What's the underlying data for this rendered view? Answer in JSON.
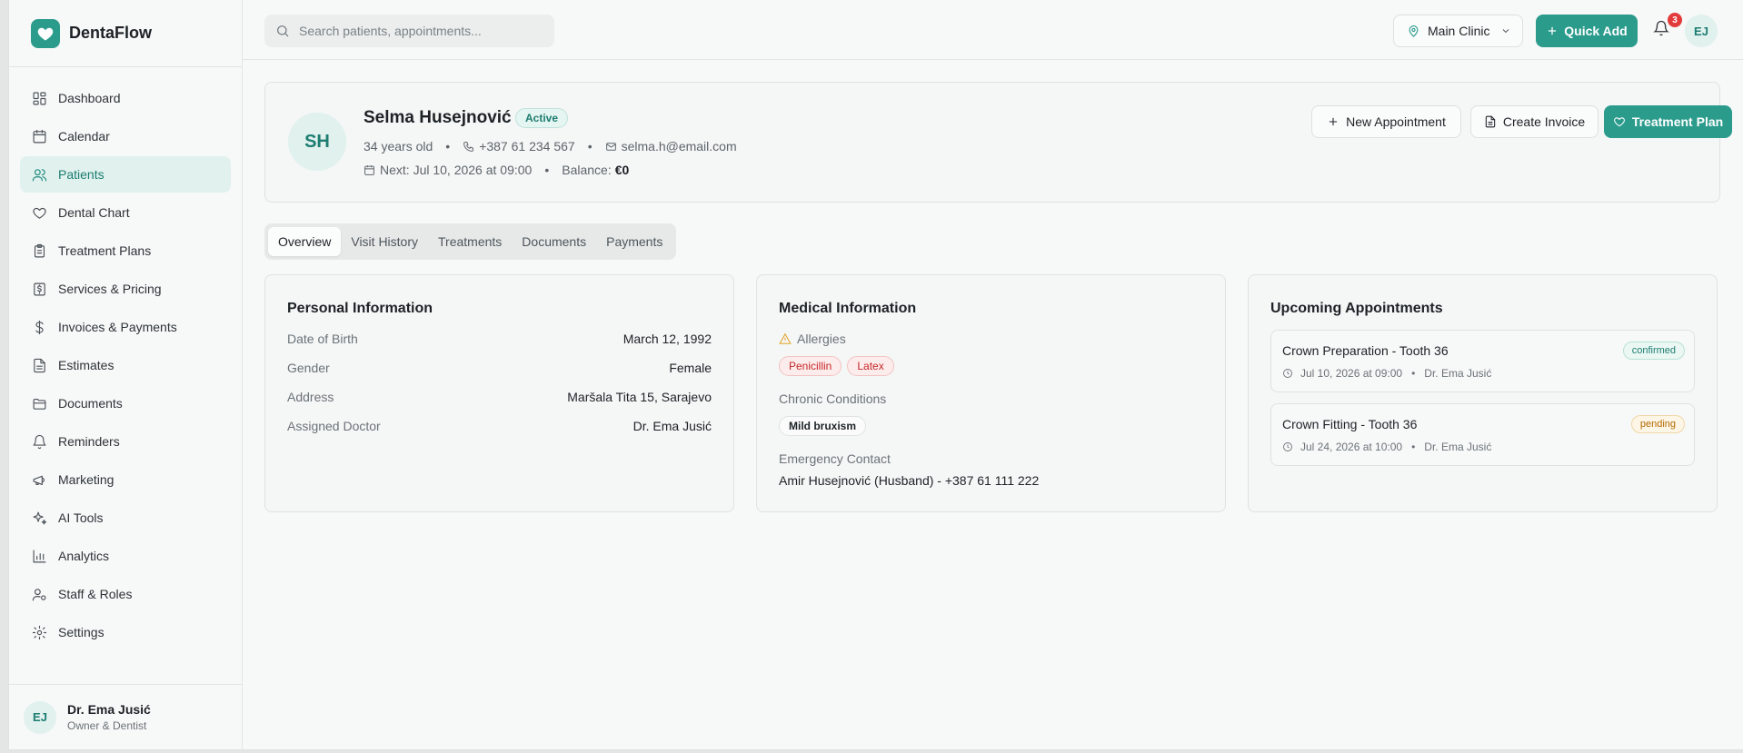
{
  "brand": {
    "name": "DentaFlow",
    "accent": "#2b9b8c"
  },
  "sidebar": {
    "items": [
      {
        "label": "Dashboard",
        "icon": "dashboard-icon"
      },
      {
        "label": "Calendar",
        "icon": "calendar-icon"
      },
      {
        "label": "Patients",
        "icon": "users-icon",
        "active": true
      },
      {
        "label": "Dental Chart",
        "icon": "heart-icon"
      },
      {
        "label": "Treatment Plans",
        "icon": "clipboard-icon"
      },
      {
        "label": "Services & Pricing",
        "icon": "pricing-icon"
      },
      {
        "label": "Invoices & Payments",
        "icon": "dollar-icon"
      },
      {
        "label": "Estimates",
        "icon": "file-icon"
      },
      {
        "label": "Documents",
        "icon": "folder-icon"
      },
      {
        "label": "Reminders",
        "icon": "bell-icon"
      },
      {
        "label": "Marketing",
        "icon": "megaphone-icon"
      },
      {
        "label": "AI Tools",
        "icon": "sparkles-icon"
      },
      {
        "label": "Analytics",
        "icon": "bar-chart-icon"
      },
      {
        "label": "Staff & Roles",
        "icon": "user-cog-icon"
      },
      {
        "label": "Settings",
        "icon": "gear-icon"
      }
    ],
    "user": {
      "initials": "EJ",
      "name": "Dr. Ema Jusić",
      "role": "Owner & Dentist"
    }
  },
  "topbar": {
    "search_placeholder": "Search patients, appointments...",
    "clinic": "Main Clinic",
    "quick_add": "Quick Add",
    "notifications": "3",
    "avatar_initials": "EJ"
  },
  "patient": {
    "initials": "SH",
    "name": "Selma Husejnović",
    "status": "Active",
    "age": "34 years old",
    "phone": "+387 61 234 567",
    "email": "selma.h@email.com",
    "next": "Next: Jul 10, 2026 at 09:00",
    "balance_label": "Balance:",
    "balance_value": "€0",
    "actions": {
      "new_appointment": "New Appointment",
      "create_invoice": "Create Invoice",
      "treatment_plan": "Treatment Plan"
    }
  },
  "tabs": [
    "Overview",
    "Visit History",
    "Treatments",
    "Documents",
    "Payments"
  ],
  "personal": {
    "title": "Personal Information",
    "rows": [
      {
        "k": "Date of Birth",
        "v": "March 12, 1992"
      },
      {
        "k": "Gender",
        "v": "Female"
      },
      {
        "k": "Address",
        "v": "Maršala Tita 15, Sarajevo"
      },
      {
        "k": "Assigned Doctor",
        "v": "Dr. Ema Jusić"
      }
    ]
  },
  "medical": {
    "title": "Medical Information",
    "allergies_label": "Allergies",
    "allergies": [
      "Penicillin",
      "Latex"
    ],
    "chronic_label": "Chronic Conditions",
    "chronic": [
      "Mild bruxism"
    ],
    "emergency_label": "Emergency Contact",
    "emergency": "Amir Husejnović (Husband) - +387 61 111 222"
  },
  "upcoming": {
    "title": "Upcoming Appointments",
    "items": [
      {
        "title": "Crown Preparation - Tooth 36",
        "when": "Jul 10, 2026 at 09:00",
        "doctor": "Dr. Ema Jusić",
        "status": "confirmed"
      },
      {
        "title": "Crown Fitting - Tooth 36",
        "when": "Jul 24, 2026 at 10:00",
        "doctor": "Dr. Ema Jusić",
        "status": "pending"
      }
    ]
  }
}
